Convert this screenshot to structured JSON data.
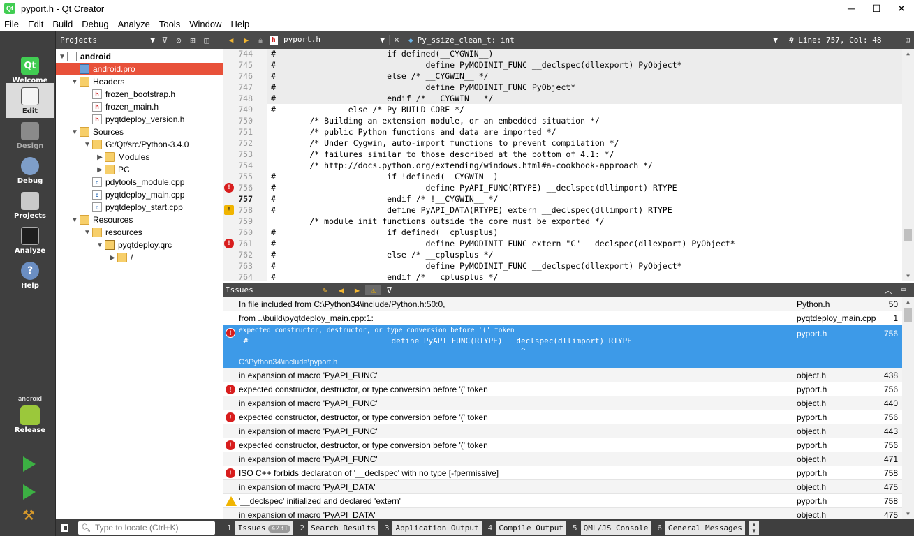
{
  "window": {
    "title": "pyport.h - Qt Creator",
    "app_icon": "qt-creator-icon",
    "controls": {
      "minimize": "─",
      "maximize": "☐",
      "close": "✕"
    }
  },
  "menu": [
    "File",
    "Edit",
    "Build",
    "Debug",
    "Analyze",
    "Tools",
    "Window",
    "Help"
  ],
  "modes": [
    {
      "label": "Welcome",
      "icon": "qt-logo-icon",
      "active": false
    },
    {
      "label": "Edit",
      "icon": "edit-document-icon",
      "active": true
    },
    {
      "label": "Design",
      "icon": "design-icon",
      "active": false
    },
    {
      "label": "Debug",
      "icon": "debug-icon",
      "active": false
    },
    {
      "label": "Projects",
      "icon": "projects-icon",
      "active": false
    },
    {
      "label": "Analyze",
      "icon": "analyze-icon",
      "active": false
    },
    {
      "label": "Help",
      "icon": "help-icon",
      "active": false
    }
  ],
  "kit": {
    "name": "android",
    "build": "Release"
  },
  "projects": {
    "header": "Projects",
    "tree": [
      {
        "label": "android",
        "level": 0,
        "arrow": "▼",
        "icon": "project",
        "bold": true
      },
      {
        "label": "android.pro",
        "level": 1,
        "arrow": "",
        "icon": "pro-file",
        "selected": true
      },
      {
        "label": "Headers",
        "level": 1,
        "arrow": "▼",
        "icon": "header-folder"
      },
      {
        "label": "frozen_bootstrap.h",
        "level": 2,
        "arrow": "",
        "icon": "h-file"
      },
      {
        "label": "frozen_main.h",
        "level": 2,
        "arrow": "",
        "icon": "h-file"
      },
      {
        "label": "pyqtdeploy_version.h",
        "level": 2,
        "arrow": "",
        "icon": "h-file"
      },
      {
        "label": "Sources",
        "level": 1,
        "arrow": "▼",
        "icon": "source-folder"
      },
      {
        "label": "G:/Qt/src/Python-3.4.0",
        "level": 2,
        "arrow": "▼",
        "icon": "folder"
      },
      {
        "label": "Modules",
        "level": 3,
        "arrow": "▶",
        "icon": "folder"
      },
      {
        "label": "PC",
        "level": 3,
        "arrow": "▶",
        "icon": "folder"
      },
      {
        "label": "pdytools_module.cpp",
        "level": 2,
        "arrow": "",
        "icon": "cpp-file"
      },
      {
        "label": "pyqtdeploy_main.cpp",
        "level": 2,
        "arrow": "",
        "icon": "cpp-file"
      },
      {
        "label": "pyqtdeploy_start.cpp",
        "level": 2,
        "arrow": "",
        "icon": "cpp-file"
      },
      {
        "label": "Resources",
        "level": 1,
        "arrow": "▼",
        "icon": "resource-folder"
      },
      {
        "label": "resources",
        "level": 2,
        "arrow": "▼",
        "icon": "folder"
      },
      {
        "label": "pyqtdeploy.qrc",
        "level": 3,
        "arrow": "▼",
        "icon": "qrc-file"
      },
      {
        "label": "/",
        "level": 4,
        "arrow": "▶",
        "icon": "folder"
      }
    ]
  },
  "editor_toolbar": {
    "file": "pyport.h",
    "symbol": "Py_ssize_clean_t: int",
    "position": "#  Line: 757, Col: 48"
  },
  "code": [
    {
      "line": "744",
      "text": "#                       if defined(__CYGWIN__)",
      "marker": ""
    },
    {
      "line": "745",
      "text": "#                               define PyMODINIT_FUNC __declspec(dllexport) PyObject*",
      "marker": ""
    },
    {
      "line": "746",
      "text": "#                       else /* __CYGWIN__ */",
      "marker": ""
    },
    {
      "line": "747",
      "text": "#                               define PyMODINIT_FUNC PyObject*",
      "marker": ""
    },
    {
      "line": "748",
      "text": "#                       endif /* __CYGWIN__ */",
      "marker": ""
    },
    {
      "line": "749",
      "text": "#               else /* Py_BUILD_CORE */",
      "marker": ""
    },
    {
      "line": "750",
      "text": "        /* Building an extension module, or an embedded situation */",
      "marker": ""
    },
    {
      "line": "751",
      "text": "        /* public Python functions and data are imported */",
      "marker": ""
    },
    {
      "line": "752",
      "text": "        /* Under Cygwin, auto-import functions to prevent compilation */",
      "marker": ""
    },
    {
      "line": "753",
      "text": "        /* failures similar to those described at the bottom of 4.1: */",
      "marker": ""
    },
    {
      "line": "754",
      "text": "        /* http://docs.python.org/extending/windows.html#a-cookbook-approach */",
      "marker": ""
    },
    {
      "line": "755",
      "text": "#                       if !defined(__CYGWIN__)",
      "marker": ""
    },
    {
      "line": "756",
      "text": "#                               define PyAPI_FUNC(RTYPE) __declspec(dllimport) RTYPE",
      "marker": "error"
    },
    {
      "line": "757",
      "text": "#                       endif /* !__CYGWIN__ */",
      "marker": ""
    },
    {
      "line": "758",
      "text": "#                       define PyAPI_DATA(RTYPE) extern __declspec(dllimport) RTYPE",
      "marker": "warning"
    },
    {
      "line": "759",
      "text": "        /* module init functions outside the core must be exported */",
      "marker": ""
    },
    {
      "line": "760",
      "text": "#                       if defined(__cplusplus)",
      "marker": ""
    },
    {
      "line": "761",
      "text": "#                               define PyMODINIT_FUNC extern \"C\" __declspec(dllexport) PyObject*",
      "marker": "error"
    },
    {
      "line": "762",
      "text": "#                       else /* __cplusplus */",
      "marker": ""
    },
    {
      "line": "763",
      "text": "#                               define PyMODINIT_FUNC __declspec(dllexport) PyObject*",
      "marker": ""
    },
    {
      "line": "764",
      "text": "#                       endif /* __cplusplus */",
      "marker": ""
    }
  ],
  "current_line": "757",
  "issues_pane": {
    "title": "Issues"
  },
  "issues_top": [
    {
      "icon": "",
      "msg": "In file included from C:\\Python34\\include/Python.h:50:0,",
      "file": "Python.h",
      "line": "50"
    },
    {
      "icon": "",
      "msg": "from ..\\build\\pyqtdeploy_main.cpp:1:",
      "file": "pyqtdeploy_main.cpp",
      "line": "1"
    }
  ],
  "issue_selected": {
    "msg": "expected constructor, destructor, or type conversion before '(' token",
    "code": " #                               define PyAPI_FUNC(RTYPE) __declspec(dllimport) RTYPE",
    "caret": "                                                             ^",
    "path": "C:\\Python34\\include\\pyport.h",
    "file": "pyport.h",
    "line": "756"
  },
  "issues_rest": [
    {
      "icon": "",
      "msg": "in expansion of macro 'PyAPI_FUNC'",
      "file": "object.h",
      "line": "438"
    },
    {
      "icon": "error",
      "msg": "expected constructor, destructor, or type conversion before '(' token",
      "file": "pyport.h",
      "line": "756"
    },
    {
      "icon": "",
      "msg": "in expansion of macro 'PyAPI_FUNC'",
      "file": "object.h",
      "line": "440"
    },
    {
      "icon": "error",
      "msg": "expected constructor, destructor, or type conversion before '(' token",
      "file": "pyport.h",
      "line": "756"
    },
    {
      "icon": "",
      "msg": "in expansion of macro 'PyAPI_FUNC'",
      "file": "object.h",
      "line": "443"
    },
    {
      "icon": "error",
      "msg": "expected constructor, destructor, or type conversion before '(' token",
      "file": "pyport.h",
      "line": "756"
    },
    {
      "icon": "",
      "msg": "in expansion of macro 'PyAPI_FUNC'",
      "file": "object.h",
      "line": "471"
    },
    {
      "icon": "error",
      "msg": "ISO C++ forbids declaration of '__declspec' with no type [-fpermissive]",
      "file": "pyport.h",
      "line": "758"
    },
    {
      "icon": "",
      "msg": "in expansion of macro 'PyAPI_DATA'",
      "file": "object.h",
      "line": "475"
    },
    {
      "icon": "warning",
      "msg": "'__declspec' initialized and declared 'extern'",
      "file": "pyport.h",
      "line": "758"
    },
    {
      "icon": "",
      "msg": "in expansion of macro 'PyAPI_DATA'",
      "file": "object.h",
      "line": "475"
    }
  ],
  "statusbar": {
    "locator_placeholder": "Type to locate (Ctrl+K)",
    "tabs": [
      {
        "num": "1",
        "label": "Issues",
        "count": "4231"
      },
      {
        "num": "2",
        "label": "Search Results",
        "count": ""
      },
      {
        "num": "3",
        "label": "Application Output",
        "count": ""
      },
      {
        "num": "4",
        "label": "Compile Output",
        "count": ""
      },
      {
        "num": "5",
        "label": "QML/JS Console",
        "count": ""
      },
      {
        "num": "6",
        "label": "General Messages",
        "count": ""
      }
    ]
  },
  "colors": {
    "selection_red": "#e8513a",
    "issue_selected_blue": "#3d9ae8",
    "dark_panel": "#4a4a4a",
    "mode_bar": "#3f3f3f"
  }
}
